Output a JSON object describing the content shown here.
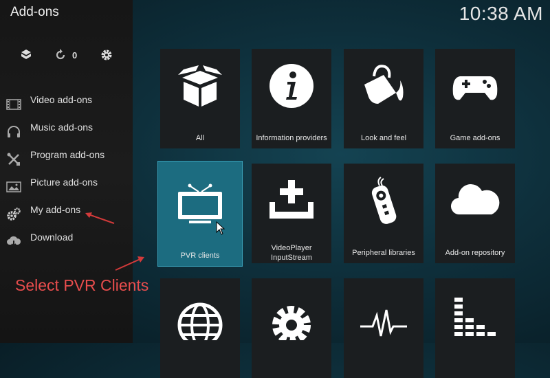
{
  "window_title": "Add-ons",
  "clock": "10:38 AM",
  "toolbar": {
    "update_count": "0",
    "icons": [
      "box-search-icon",
      "refresh-icon",
      "gear-icon"
    ]
  },
  "sidebar": {
    "items": [
      {
        "label": "Video add-ons",
        "icon": "film-strip-icon"
      },
      {
        "label": "Music add-ons",
        "icon": "headphones-icon"
      },
      {
        "label": "Program add-ons",
        "icon": "tools-icon"
      },
      {
        "label": "Picture add-ons",
        "icon": "picture-icon"
      },
      {
        "label": "My add-ons",
        "icon": "gears-icon"
      },
      {
        "label": "Download",
        "icon": "cloud-download-icon"
      }
    ]
  },
  "tiles": [
    {
      "label": "All",
      "icon": "open-box-icon"
    },
    {
      "label": "Information providers",
      "icon": "info-icon"
    },
    {
      "label": "Look and feel",
      "icon": "paint-bucket-icon"
    },
    {
      "label": "Game add-ons",
      "icon": "gamepad-icon"
    },
    {
      "label": "PVR clients",
      "icon": "tv-icon",
      "focused": true
    },
    {
      "label": "VideoPlayer InputStream",
      "line1": "VideoPlayer",
      "line2": "InputStream",
      "icon": "inbox-plus-icon"
    },
    {
      "label": "Peripheral libraries",
      "icon": "remote-control-icon"
    },
    {
      "label": "Add-on repository",
      "icon": "cloud-icon"
    },
    {
      "label": "",
      "icon": "globe-icon"
    },
    {
      "label": "",
      "icon": "cog-icon"
    },
    {
      "label": "",
      "icon": "waveform-icon"
    },
    {
      "label": "",
      "icon": "equalizer-icon"
    }
  ],
  "annotation": {
    "text": "Select PVR Clients",
    "color": "#e84d4d"
  }
}
